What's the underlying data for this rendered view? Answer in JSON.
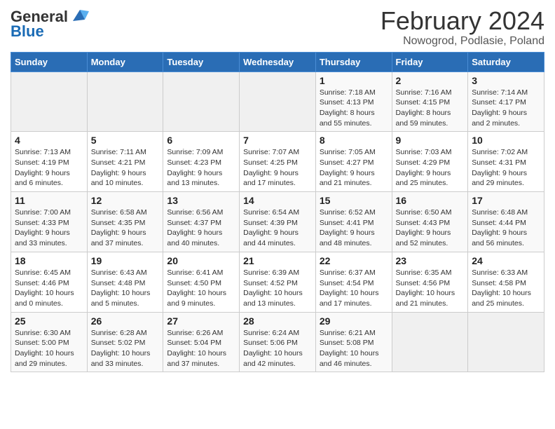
{
  "logo": {
    "text_general": "General",
    "text_blue": "Blue"
  },
  "title": "February 2024",
  "location": "Nowogrod, Podlasie, Poland",
  "days_of_week": [
    "Sunday",
    "Monday",
    "Tuesday",
    "Wednesday",
    "Thursday",
    "Friday",
    "Saturday"
  ],
  "weeks": [
    [
      {
        "day": "",
        "info": ""
      },
      {
        "day": "",
        "info": ""
      },
      {
        "day": "",
        "info": ""
      },
      {
        "day": "",
        "info": ""
      },
      {
        "day": "1",
        "info": "Sunrise: 7:18 AM\nSunset: 4:13 PM\nDaylight: 8 hours\nand 55 minutes."
      },
      {
        "day": "2",
        "info": "Sunrise: 7:16 AM\nSunset: 4:15 PM\nDaylight: 8 hours\nand 59 minutes."
      },
      {
        "day": "3",
        "info": "Sunrise: 7:14 AM\nSunset: 4:17 PM\nDaylight: 9 hours\nand 2 minutes."
      }
    ],
    [
      {
        "day": "4",
        "info": "Sunrise: 7:13 AM\nSunset: 4:19 PM\nDaylight: 9 hours\nand 6 minutes."
      },
      {
        "day": "5",
        "info": "Sunrise: 7:11 AM\nSunset: 4:21 PM\nDaylight: 9 hours\nand 10 minutes."
      },
      {
        "day": "6",
        "info": "Sunrise: 7:09 AM\nSunset: 4:23 PM\nDaylight: 9 hours\nand 13 minutes."
      },
      {
        "day": "7",
        "info": "Sunrise: 7:07 AM\nSunset: 4:25 PM\nDaylight: 9 hours\nand 17 minutes."
      },
      {
        "day": "8",
        "info": "Sunrise: 7:05 AM\nSunset: 4:27 PM\nDaylight: 9 hours\nand 21 minutes."
      },
      {
        "day": "9",
        "info": "Sunrise: 7:03 AM\nSunset: 4:29 PM\nDaylight: 9 hours\nand 25 minutes."
      },
      {
        "day": "10",
        "info": "Sunrise: 7:02 AM\nSunset: 4:31 PM\nDaylight: 9 hours\nand 29 minutes."
      }
    ],
    [
      {
        "day": "11",
        "info": "Sunrise: 7:00 AM\nSunset: 4:33 PM\nDaylight: 9 hours\nand 33 minutes."
      },
      {
        "day": "12",
        "info": "Sunrise: 6:58 AM\nSunset: 4:35 PM\nDaylight: 9 hours\nand 37 minutes."
      },
      {
        "day": "13",
        "info": "Sunrise: 6:56 AM\nSunset: 4:37 PM\nDaylight: 9 hours\nand 40 minutes."
      },
      {
        "day": "14",
        "info": "Sunrise: 6:54 AM\nSunset: 4:39 PM\nDaylight: 9 hours\nand 44 minutes."
      },
      {
        "day": "15",
        "info": "Sunrise: 6:52 AM\nSunset: 4:41 PM\nDaylight: 9 hours\nand 48 minutes."
      },
      {
        "day": "16",
        "info": "Sunrise: 6:50 AM\nSunset: 4:43 PM\nDaylight: 9 hours\nand 52 minutes."
      },
      {
        "day": "17",
        "info": "Sunrise: 6:48 AM\nSunset: 4:44 PM\nDaylight: 9 hours\nand 56 minutes."
      }
    ],
    [
      {
        "day": "18",
        "info": "Sunrise: 6:45 AM\nSunset: 4:46 PM\nDaylight: 10 hours\nand 0 minutes."
      },
      {
        "day": "19",
        "info": "Sunrise: 6:43 AM\nSunset: 4:48 PM\nDaylight: 10 hours\nand 5 minutes."
      },
      {
        "day": "20",
        "info": "Sunrise: 6:41 AM\nSunset: 4:50 PM\nDaylight: 10 hours\nand 9 minutes."
      },
      {
        "day": "21",
        "info": "Sunrise: 6:39 AM\nSunset: 4:52 PM\nDaylight: 10 hours\nand 13 minutes."
      },
      {
        "day": "22",
        "info": "Sunrise: 6:37 AM\nSunset: 4:54 PM\nDaylight: 10 hours\nand 17 minutes."
      },
      {
        "day": "23",
        "info": "Sunrise: 6:35 AM\nSunset: 4:56 PM\nDaylight: 10 hours\nand 21 minutes."
      },
      {
        "day": "24",
        "info": "Sunrise: 6:33 AM\nSunset: 4:58 PM\nDaylight: 10 hours\nand 25 minutes."
      }
    ],
    [
      {
        "day": "25",
        "info": "Sunrise: 6:30 AM\nSunset: 5:00 PM\nDaylight: 10 hours\nand 29 minutes."
      },
      {
        "day": "26",
        "info": "Sunrise: 6:28 AM\nSunset: 5:02 PM\nDaylight: 10 hours\nand 33 minutes."
      },
      {
        "day": "27",
        "info": "Sunrise: 6:26 AM\nSunset: 5:04 PM\nDaylight: 10 hours\nand 37 minutes."
      },
      {
        "day": "28",
        "info": "Sunrise: 6:24 AM\nSunset: 5:06 PM\nDaylight: 10 hours\nand 42 minutes."
      },
      {
        "day": "29",
        "info": "Sunrise: 6:21 AM\nSunset: 5:08 PM\nDaylight: 10 hours\nand 46 minutes."
      },
      {
        "day": "",
        "info": ""
      },
      {
        "day": "",
        "info": ""
      }
    ]
  ]
}
